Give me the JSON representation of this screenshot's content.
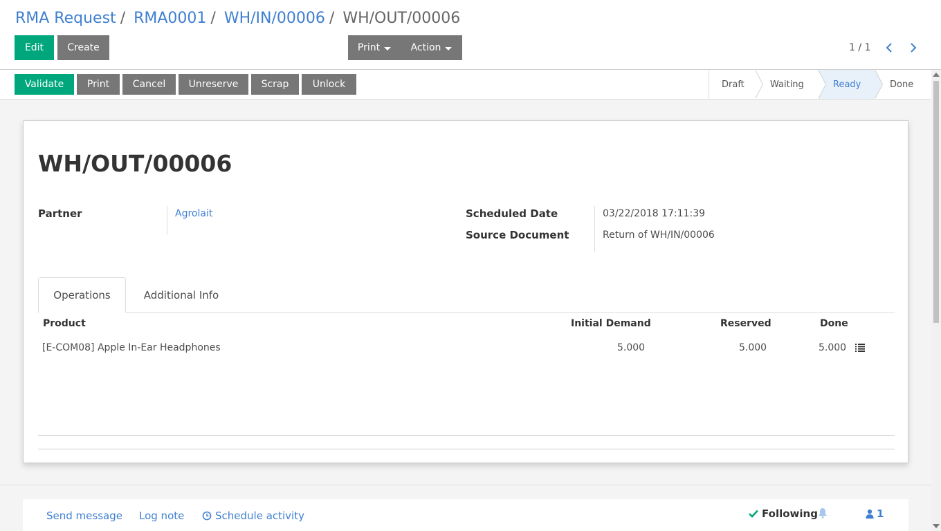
{
  "breadcrumb": [
    {
      "label": "RMA Request"
    },
    {
      "label": "RMA0001"
    },
    {
      "label": "WH/IN/00006"
    },
    {
      "label": "WH/OUT/00006"
    }
  ],
  "breadcrumb_sep": "/",
  "toolbar": {
    "edit_label": "Edit",
    "create_label": "Create",
    "print_label": "Print",
    "action_label": "Action"
  },
  "pager": {
    "value": "1 / 1"
  },
  "statusbar": {
    "validate": "Validate",
    "print": "Print",
    "cancel": "Cancel",
    "unreserve": "Unreserve",
    "scrap": "Scrap",
    "unlock": "Unlock",
    "stages": [
      "Draft",
      "Waiting",
      "Ready",
      "Done"
    ],
    "current_stage": "Ready"
  },
  "record": {
    "title": "WH/OUT/00006",
    "partner_label": "Partner",
    "partner_value": "Agrolait",
    "scheduled_date_label": "Scheduled Date",
    "scheduled_date_value": "03/22/2018 17:11:39",
    "source_document_label": "Source Document",
    "source_document_value": "Return of WH/IN/00006"
  },
  "tabs": [
    {
      "label": "Operations",
      "active": true
    },
    {
      "label": "Additional Info",
      "active": false
    }
  ],
  "operations": {
    "columns": [
      "Product",
      "Initial Demand",
      "Reserved",
      "Done"
    ],
    "rows": [
      {
        "product": "[E-COM08] Apple In-Ear Headphones",
        "initial_demand": "5.000",
        "reserved": "5.000",
        "done": "5.000",
        "icon": "list-icon"
      }
    ]
  },
  "chatter": {
    "send_message": "Send message",
    "log_note": "Log note",
    "schedule_activity": "Schedule activity",
    "following": "Following",
    "followers_count": "1"
  },
  "colors": {
    "primary": "#00a77c",
    "secondary": "#777777",
    "link": "#3f7fd1"
  }
}
